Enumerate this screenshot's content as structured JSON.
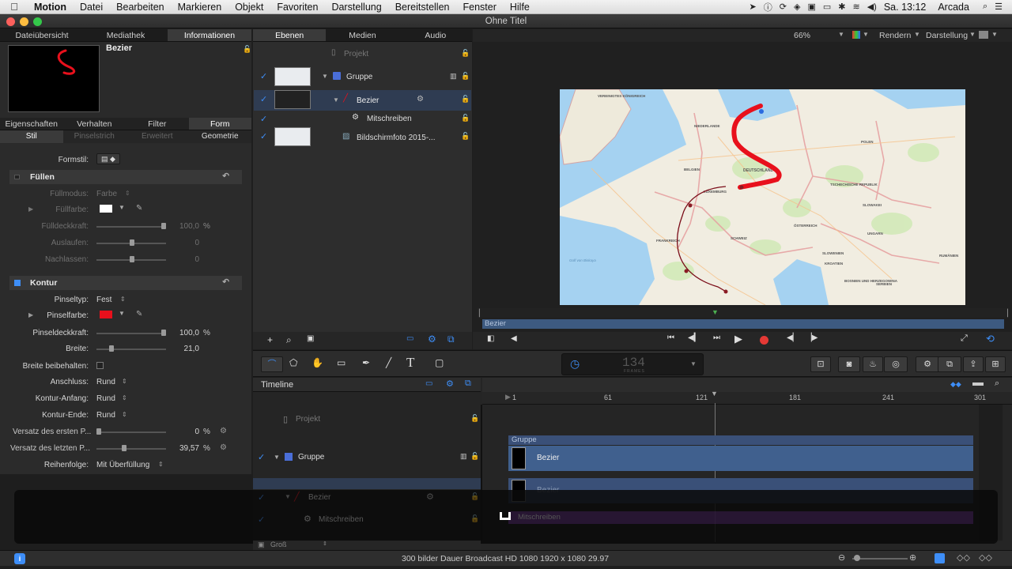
{
  "menu": {
    "app": "Motion",
    "items": [
      "Datei",
      "Bearbeiten",
      "Markieren",
      "Objekt",
      "Favoriten",
      "Darstellung",
      "Bereitstellen",
      "Fenster",
      "Hilfe"
    ],
    "clock": "Sa. 13:12",
    "user": "Arcada"
  },
  "window": {
    "title": "Ohne Titel"
  },
  "left": {
    "tabs": [
      "Dateiübersicht",
      "Mediathek",
      "Informationen"
    ],
    "preview_name": "Bezier",
    "insp_tabs": [
      "Eigenschaften",
      "Verhalten",
      "Filter",
      "Form"
    ],
    "sub_tabs": [
      "Stil",
      "Pinselstrich",
      "Erweitert",
      "Geometrie"
    ],
    "formstil": "Formstil:",
    "fill": {
      "title": "Füllen",
      "fuellmodus_label": "Füllmodus:",
      "fuellmodus": "Farbe",
      "fuellfarbe_label": "Füllfarbe:",
      "deckkraft_label": "Fülldeckkraft:",
      "deckkraft": "100,0",
      "pct": "%",
      "auslaufen_label": "Auslaufen:",
      "auslaufen": "0",
      "nachlassen_label": "Nachlassen:",
      "nachlassen": "0"
    },
    "kontur": {
      "title": "Kontur",
      "pinseltyp_label": "Pinseltyp:",
      "pinseltyp": "Fest",
      "pinselfarbe_label": "Pinselfarbe:",
      "pinseldeckkraft_label": "Pinseldeckkraft:",
      "pinseldeckkraft": "100,0",
      "breite_label": "Breite:",
      "breite": "21,0",
      "breite_beibehalten_label": "Breite beibehalten:",
      "anschluss_label": "Anschluss:",
      "anschluss": "Rund",
      "anfang_label": "Kontur-Anfang:",
      "anfang": "Rund",
      "ende_label": "Kontur-Ende:",
      "ende": "Rund",
      "versatz1_label": "Versatz des ersten P...",
      "versatz1": "0",
      "versatz2_label": "Versatz des letzten P...",
      "versatz2": "39,57",
      "reihenfolge_label": "Reihenfolge:",
      "reihenfolge": "Mit Überfüllung"
    }
  },
  "layers": {
    "tabs": [
      "Ebenen",
      "Medien",
      "Audio"
    ],
    "projekt": "Projekt",
    "gruppe": "Gruppe",
    "bezier": "Bezier",
    "mitschreiben": "Mitschreiben",
    "bild": "Bildschirmfoto 2015-..."
  },
  "canvas": {
    "zoom": "66%",
    "render": "Rendern",
    "darstellung": "Darstellung",
    "mini_label": "Bezier",
    "map": {
      "countries": [
        "VEREINIGTES KÖNIGREICH",
        "NIEDERLANDE",
        "BELGIEN",
        "DEUTSCHLAND",
        "POLEN",
        "TSCHECHISCHE REPUBLIK",
        "FRANKREICH",
        "SCHWEIZ",
        "ÖSTERREICH",
        "SLOWAKEI",
        "UNGARN",
        "SLOWENIEN",
        "KROATIEN",
        "RUMÄNIEN",
        "BOSNIEN UND HERZEGOWINA",
        "SERBIEN",
        "LUXEMBURG"
      ],
      "sea": "Golf von Biskaya"
    }
  },
  "toolbar": {
    "frames": "134",
    "frames_label": "FRAMES"
  },
  "timeline": {
    "title": "Timeline",
    "ruler": [
      "1",
      "61",
      "121",
      "181",
      "241",
      "301"
    ],
    "projekt": "Projekt",
    "gruppe": "Gruppe",
    "bezier": "Bezier",
    "mitschreiben": "Mitschreiben",
    "bar_gruppe": "Gruppe",
    "bar_bezier": "Bezier",
    "bar_bezier2": "Bezier",
    "bar_mit": "Mitschreiben",
    "size": "Groß"
  },
  "status": {
    "text": "300 bilder Dauer Broadcast HD 1080 1920 x 1080 29.97"
  },
  "colors": {
    "accent": "#3e8ef7",
    "stroke": "#e8101c",
    "bar": "#3d5a80"
  }
}
